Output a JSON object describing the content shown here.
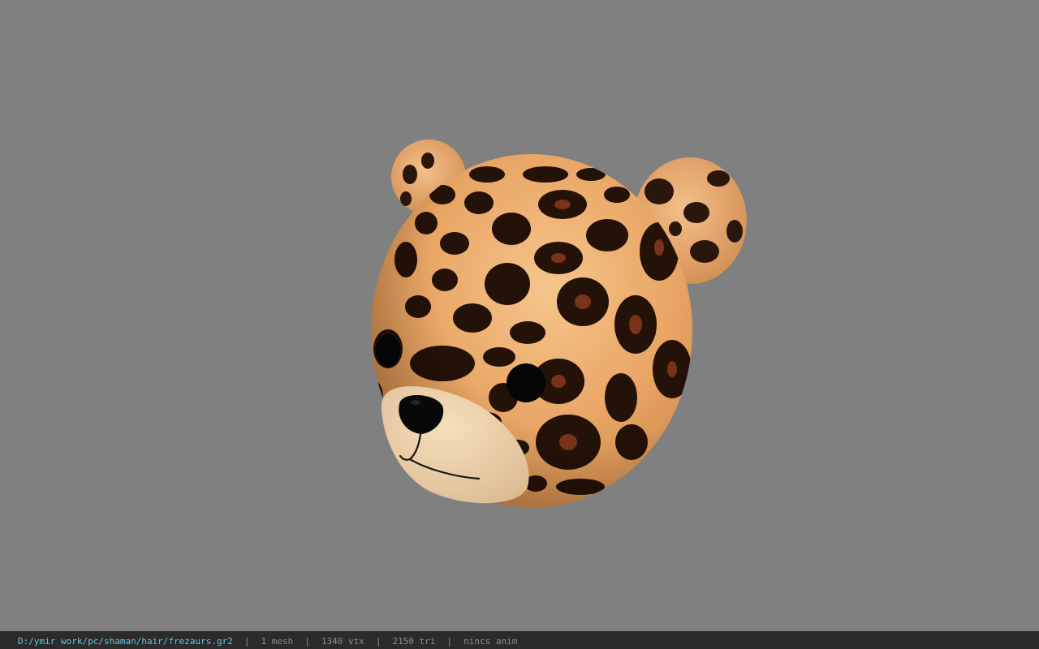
{
  "viewport": {
    "background": "#808080",
    "model_name": "leopard-print bear head"
  },
  "statusbar": {
    "file_path": "D:/ymir work/pc/shaman/hair/frezaurs.gr2",
    "separator": "|",
    "mesh_count": "1 mesh",
    "vertex_count": "1340 vtx",
    "triangle_count": "2150 tri",
    "anim_status": "nincs anim",
    "path_color": "#5ec8e6"
  }
}
